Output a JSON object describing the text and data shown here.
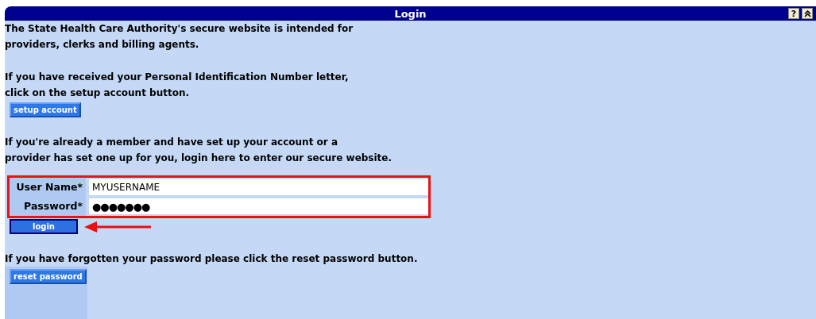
{
  "header": {
    "title": "Login",
    "help_button": "?"
  },
  "intro": [
    "The State Health Care Authority's secure website is intended for",
    "providers, clerks and billing agents."
  ],
  "setup": {
    "text": [
      "If you have received your Personal Identification Number letter,",
      "click on the setup account button."
    ],
    "button": "setup account"
  },
  "login": {
    "text": [
      "If you're already a member and have set up your account or a",
      "provider has set one up for you, login here to enter our secure website."
    ],
    "fields": [
      {
        "label": "User Name*",
        "value": "MYUSERNAME",
        "kind": "text"
      },
      {
        "label": "Password*",
        "value": "●●●●●●●",
        "kind": "password"
      }
    ],
    "button": "login",
    "highlighted": true
  },
  "reset": {
    "text": "If you have forgotten your password please click the reset password button.",
    "button": "reset password"
  }
}
